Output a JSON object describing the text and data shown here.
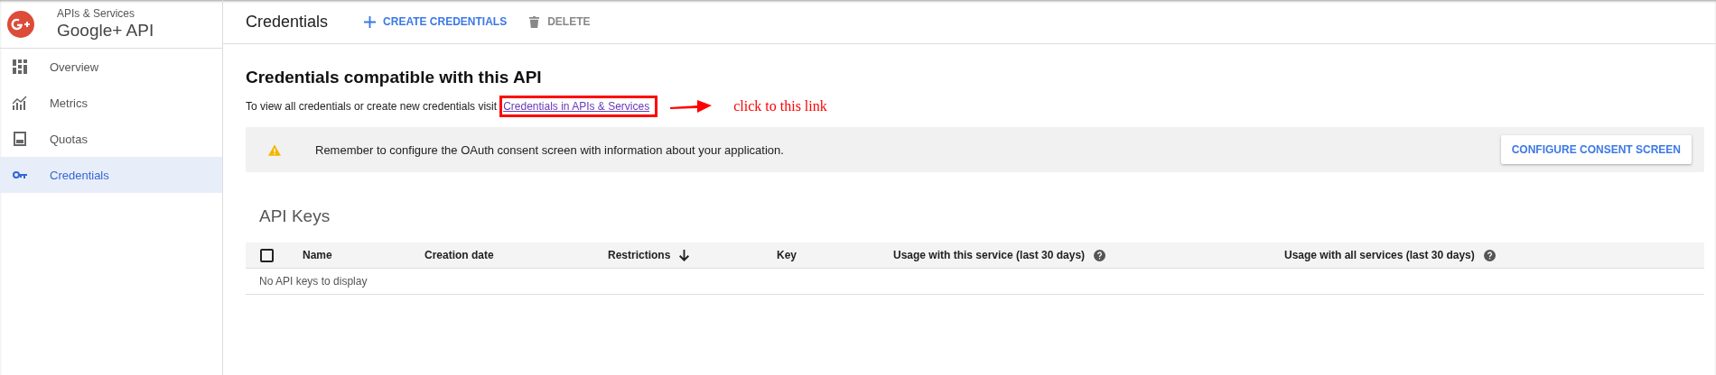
{
  "sidebar": {
    "section": "APIs & Services",
    "title": "Google+ API",
    "items": [
      {
        "label": "Overview",
        "selected": false
      },
      {
        "label": "Metrics",
        "selected": false
      },
      {
        "label": "Quotas",
        "selected": false
      },
      {
        "label": "Credentials",
        "selected": true
      }
    ]
  },
  "header": {
    "title": "Credentials",
    "actions": [
      {
        "label": "CREATE CREDENTIALS",
        "disabled": false
      },
      {
        "label": "DELETE",
        "disabled": true
      }
    ]
  },
  "main": {
    "heading": "Credentials compatible with this API",
    "intro": "To view all credentials or create new credentials visit",
    "link": "Credentials in APIs & Services",
    "annotation": "click to this link",
    "banner": {
      "message": "Remember to configure the OAuth consent screen with information about your application.",
      "button": "CONFIGURE CONSENT SCREEN"
    },
    "api_keys": {
      "title": "API Keys",
      "select_all_checked": false,
      "columns": [
        {
          "label": "Name",
          "kind": "plain"
        },
        {
          "label": "Creation date",
          "kind": "plain"
        },
        {
          "label": "Restrictions",
          "kind": "sorted"
        },
        {
          "label": "Key",
          "kind": "plain"
        },
        {
          "label": "Usage with this service (last 30 days)",
          "kind": "help"
        },
        {
          "label": "Usage with all services (last 30 days)",
          "kind": "help"
        }
      ],
      "empty": "No API keys to display"
    }
  }
}
